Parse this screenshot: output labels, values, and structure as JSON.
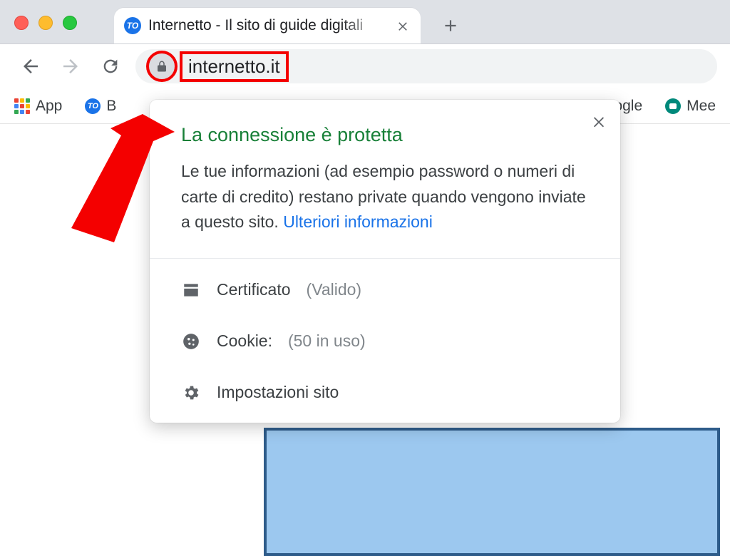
{
  "window": {
    "tab_title": "Internetto - Il sito di guide digitali"
  },
  "toolbar": {
    "url": "internetto.it"
  },
  "bookmarks": {
    "apps_label": "App",
    "item2_label_first_letter": "B",
    "item3_partial": "ogle",
    "meet_label_partial": "Mee"
  },
  "site_info_popup": {
    "title": "La connessione è protetta",
    "description_prefix": "Le tue informazioni (ad esempio password o numeri di carte di credito) restano private quando vengono inviate a questo sito. ",
    "learn_more": "Ulteriori informazioni",
    "certificate_label": "Certificato",
    "certificate_status": "(Valido)",
    "cookies_label": "Cookie:",
    "cookies_status": "(50 in uso)",
    "site_settings_label": "Impostazioni sito"
  }
}
